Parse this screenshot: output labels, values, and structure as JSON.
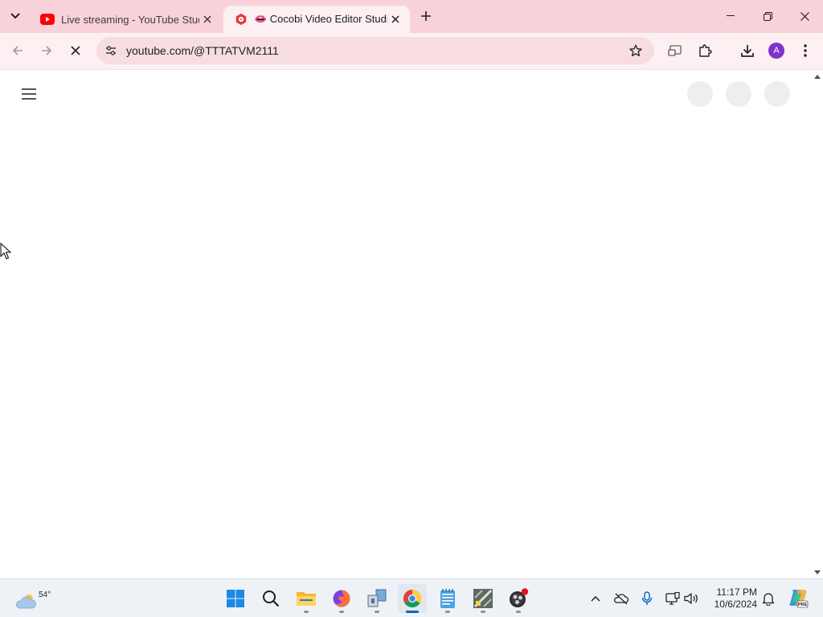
{
  "browser": {
    "tabs": [
      {
        "title": "Live streaming - YouTube Studio",
        "favicon": "youtube-icon",
        "active": false
      },
      {
        "title": "👄 Cocobi Video Editor Studio 🎬",
        "favicon": "youtube-studio-icon",
        "active": true
      }
    ],
    "url": "youtube.com/@TTTATVM2111",
    "profile_initial": "A",
    "colors": {
      "tabbar": "#f9d2d9",
      "toolbar": "#fdf0f2",
      "omnibox": "#f7dde2",
      "profile": "#7c34c9"
    }
  },
  "taskbar": {
    "weather": {
      "temp": "54°",
      "icon": "cloud-icon"
    },
    "apps": [
      "start-icon",
      "search-icon",
      "file-explorer-icon",
      "firefox-icon",
      "app-icon",
      "chrome-icon",
      "notepad-icon",
      "app-icon",
      "obs-icon"
    ],
    "clock": {
      "time": "11:17 PM",
      "date": "10/6/2024"
    }
  }
}
